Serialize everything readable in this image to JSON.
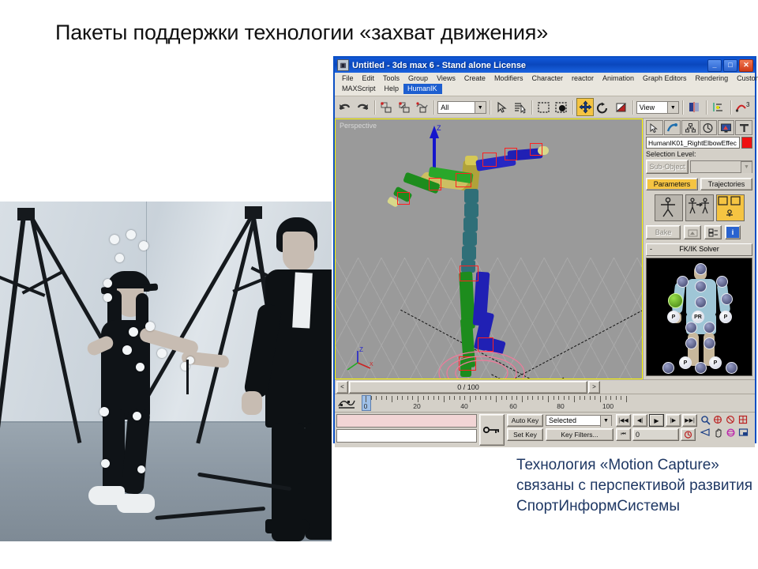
{
  "slide": {
    "title": "Пакеты поддержки технологии «захват движения»",
    "caption": "Технология «Motion Capture» связаны с перспективой развития СпортИнформСистемы",
    "caption_color": "#1f3864"
  },
  "photo": {
    "alt": "Motion capture studio photograph: woman wearing marker suit and cap with reflective markers, man in dark jacket, camera tripods",
    "tone": "black-and-white with blue tint"
  },
  "maxwin": {
    "title": "Untitled  -  3ds max 6  -  Stand alone License",
    "title_bar_color": "#0a47bd",
    "window_buttons": [
      "_",
      "□",
      "✕"
    ],
    "menu_row1": [
      "File",
      "Edit",
      "Tools",
      "Group",
      "Views",
      "Create",
      "Modifiers",
      "Character",
      "reactor",
      "Animation",
      "Graph Editors",
      "Rendering",
      "Customize"
    ],
    "menu_row2": [
      "MAXScript",
      "Help",
      "HumanIK"
    ],
    "menu_selected": "HumanIK",
    "toolbar": {
      "selection_filter": "All",
      "coord_system": "View",
      "buttons": [
        {
          "name": "undo-icon",
          "label": "Undo"
        },
        {
          "name": "redo-icon",
          "label": "Redo"
        },
        {
          "name": "select-link-icon",
          "label": "Select and Link"
        },
        {
          "name": "unlink-icon",
          "label": "Unlink Selection"
        },
        {
          "name": "bind-space-warp-icon",
          "label": "Bind to Space Warp"
        },
        {
          "name": "select-object-icon",
          "label": "Select Object"
        },
        {
          "name": "select-by-name-icon",
          "label": "Select by Name"
        },
        {
          "name": "rectangular-region-icon",
          "label": "Rectangular Selection Region"
        },
        {
          "name": "window-crossing-icon",
          "label": "Window / Crossing"
        },
        {
          "name": "select-move-icon",
          "label": "Select and Move"
        },
        {
          "name": "select-rotate-icon",
          "label": "Select and Rotate"
        },
        {
          "name": "select-scale-icon",
          "label": "Select and Uniform Scale"
        },
        {
          "name": "mirror-icon",
          "label": "Mirror"
        },
        {
          "name": "align-icon",
          "label": "Align"
        },
        {
          "name": "curve-editor-icon",
          "label": "Curve Editor"
        }
      ],
      "active_button": "select-move-icon",
      "active_color": "#f5c442"
    },
    "viewport": {
      "label": "Perspective",
      "border_color": "#fffb00",
      "background": "#9a9a9a",
      "axis_labels": {
        "up": "Z",
        "corner_z": "Z",
        "corner_x": "X",
        "corner_y": "Y"
      },
      "bone_colors": {
        "left_arm": "#1d8c1d",
        "right_arm": "#2020b4",
        "spine": "#2f6f78",
        "pelvis": "#b0a23a",
        "gizmo": "#ff2020"
      }
    },
    "command_panel": {
      "tabs": [
        {
          "name": "create-tab-icon",
          "label": "Create"
        },
        {
          "name": "modify-tab-icon",
          "label": "Modify"
        },
        {
          "name": "hierarchy-tab-icon",
          "label": "Hierarchy"
        },
        {
          "name": "motion-tab-icon",
          "label": "Motion"
        },
        {
          "name": "display-tab-icon",
          "label": "Display"
        },
        {
          "name": "utilities-tab-icon",
          "label": "Utilities"
        }
      ],
      "object_name": "HumanIK01_RightElbowEffec",
      "object_color": "#ef1111",
      "selection_level_label": "Selection Level:",
      "sub_object_button": "Sub-Object",
      "sub_object_value": "",
      "param_tabs": [
        {
          "label": "Parameters",
          "active": true
        },
        {
          "label": "Trajectories",
          "active": false
        }
      ],
      "mode_icons": [
        {
          "name": "biped-figure-mode-icon",
          "active": false
        },
        {
          "name": "biped-footstep-mode-icon",
          "active": false
        },
        {
          "name": "biped-motion-flow-icon",
          "active": true
        }
      ],
      "bake_row": [
        {
          "label": "Bake",
          "name": "bake-button",
          "disabled": true
        },
        {
          "label": "",
          "name": "snapshot-icon",
          "disabled": true
        },
        {
          "label": "",
          "name": "key-list-icon",
          "disabled": false
        },
        {
          "label": "",
          "name": "info-icon",
          "disabled": false
        }
      ],
      "rollout": {
        "title": "FK/IK Solver",
        "collapse_glyph": "-"
      },
      "ik_diagram": {
        "markers": [
          "P",
          "PR",
          "P",
          "P",
          "P"
        ],
        "highlighted_joint": "left-elbow",
        "highlight_color": "#9ae24a"
      }
    },
    "time_slider": {
      "value": "0 / 100",
      "prev_glyph": "<",
      "next_glyph": ">"
    },
    "track_bar": {
      "ticks": [
        0,
        20,
        40,
        60,
        80,
        100
      ],
      "range_start": 0,
      "range_end": 100,
      "current_frame": 0
    },
    "status_bar": {
      "auto_key": "Auto Key",
      "set_key": "Set Key",
      "key_mode": "Selected",
      "key_filters": "Key Filters...",
      "frame_field": "0",
      "prompt_line": "",
      "status_line": "",
      "playback_buttons": [
        {
          "name": "goto-start-icon",
          "glyph": "|◀◀"
        },
        {
          "name": "previous-frame-icon",
          "glyph": "◀|"
        },
        {
          "name": "play-animation-icon",
          "glyph": "▶"
        },
        {
          "name": "next-frame-icon",
          "glyph": "|▶"
        },
        {
          "name": "goto-end-icon",
          "glyph": "▶▶|"
        }
      ],
      "nav_buttons": [
        {
          "name": "zoom-icon"
        },
        {
          "name": "zoom-all-icon"
        },
        {
          "name": "zoom-extents-icon"
        },
        {
          "name": "zoom-extents-all-icon"
        },
        {
          "name": "field-of-view-icon"
        },
        {
          "name": "pan-icon"
        },
        {
          "name": "arc-rotate-icon"
        },
        {
          "name": "min-max-toggle-icon"
        }
      ]
    }
  }
}
